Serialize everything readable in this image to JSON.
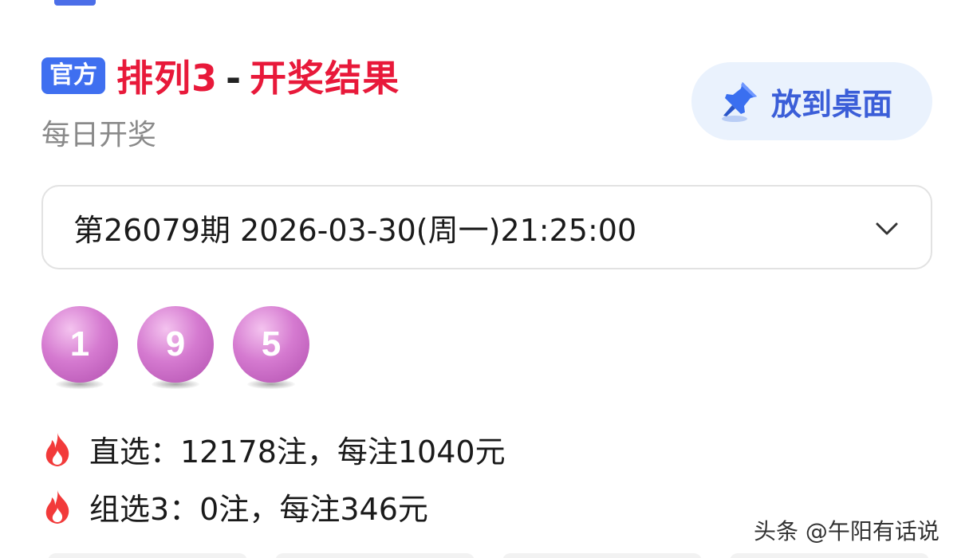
{
  "header": {
    "badge": "官方",
    "title_game": "排列3",
    "title_sep": "-",
    "title_result": "开奖结果",
    "subtitle": "每日开奖"
  },
  "pin_button": {
    "icon": "pushpin-icon",
    "label": "放到桌面"
  },
  "issue_select": {
    "value": "第26079期 2026-03-30(周一)21:25:00",
    "icon": "chevron-down-icon"
  },
  "balls": [
    "1",
    "9",
    "5"
  ],
  "prizes": [
    {
      "icon": "flame-icon",
      "text": "直选：12178注，每注1040元"
    },
    {
      "icon": "flame-icon",
      "text": "组选3：0注，每注346元"
    }
  ],
  "watermark": "头条 @午阳有话说",
  "colors": {
    "title_red": "#e8193a",
    "badge_blue": "#3f6ff0",
    "pin_bg": "#eaf2fd",
    "pin_text": "#3b5ed8",
    "ball_purple": "#c766c4",
    "flame_red": "#f23a3a"
  }
}
